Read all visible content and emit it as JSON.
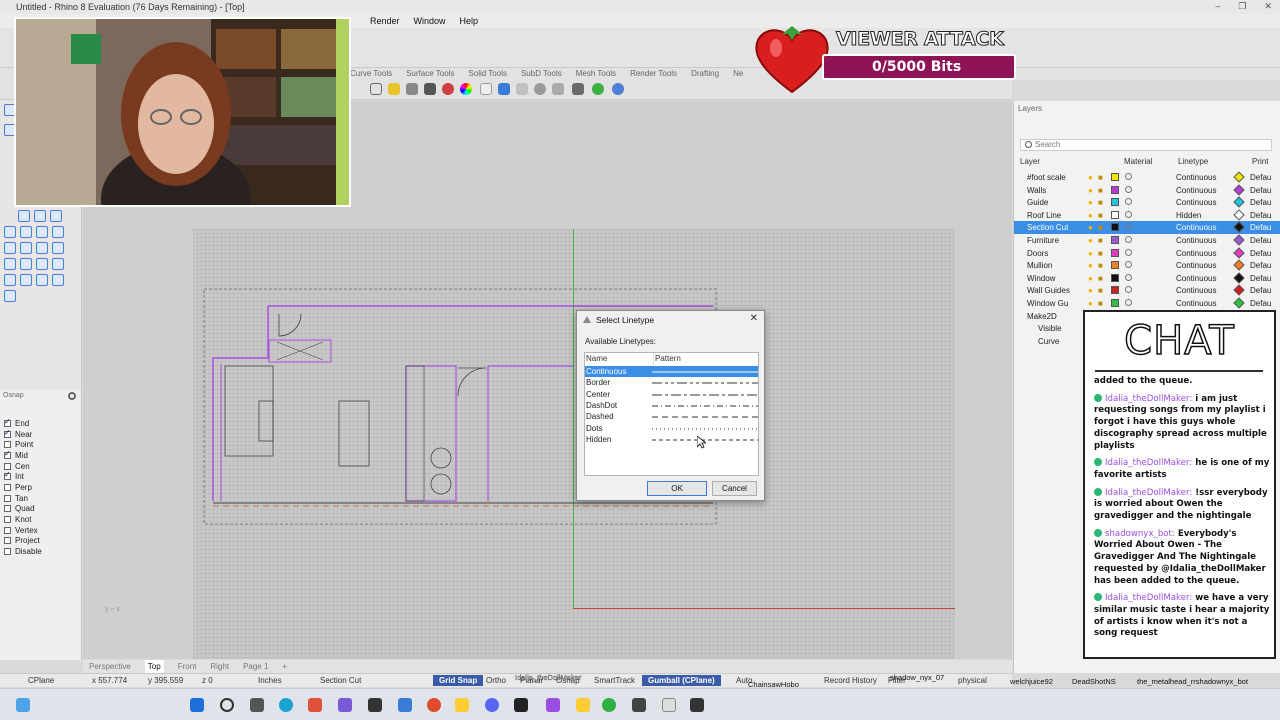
{
  "window": {
    "title": "Untitled - Rhino 8 Evaluation (76 Days Remaining) - [Top]",
    "controls": [
      "–",
      "❐",
      "✕"
    ]
  },
  "menu": [
    "Render",
    "Window",
    "Help"
  ],
  "toolbar_tabs": [
    "Drafting",
    "Curve Tools",
    "Surface Tools",
    "Solid Tools",
    "SubD Tools",
    "Mesh Tools",
    "Render Tools",
    "Drafting",
    "Ne"
  ],
  "osnap": {
    "header": "Osnap",
    "items": [
      {
        "label": "End",
        "checked": true
      },
      {
        "label": "Near",
        "checked": true
      },
      {
        "label": "Point",
        "checked": false
      },
      {
        "label": "Mid",
        "checked": true
      },
      {
        "label": "Cen",
        "checked": false
      },
      {
        "label": "Int",
        "checked": true
      },
      {
        "label": "Perp",
        "checked": false
      },
      {
        "label": "Tan",
        "checked": false
      },
      {
        "label": "Quad",
        "checked": false
      },
      {
        "label": "Knot",
        "checked": false
      },
      {
        "label": "Vertex",
        "checked": false
      },
      {
        "label": "Project",
        "checked": false
      },
      {
        "label": "Disable",
        "checked": false
      }
    ]
  },
  "viewport_tabs": [
    "Perspective",
    "Top",
    "Front",
    "Right",
    "Page 1",
    "+"
  ],
  "status": {
    "cplane": "CPlane",
    "x": "x 557.774",
    "y": "y 395.559",
    "z": "z 0",
    "units": "Inches",
    "layer": "Section Cut",
    "grid_snap": "Grid Snap",
    "ortho": "Ortho",
    "planar": "Planar",
    "osnap": "Osnap",
    "smarttrack": "SmartTrack",
    "gumball": "Gumball (CPlane)",
    "auto": "Auto",
    "record": "Record History",
    "filter": "Filter",
    "physical": "physical"
  },
  "layers": {
    "panel_title": "Layers",
    "search_placeholder": "Search",
    "columns": [
      "Layer",
      "Material",
      "Linetype",
      "Print"
    ],
    "rows": [
      {
        "name": "#foot scale",
        "color": "#f2e600",
        "linetype": "Continuous",
        "print_color": "#f2e600",
        "print": "Defau",
        "selected": false
      },
      {
        "name": "Walls",
        "color": "#b63bd6",
        "linetype": "Continuous",
        "print_color": "#b63bd6",
        "print": "Defau",
        "selected": false
      },
      {
        "name": "Guide",
        "color": "#24c3e0",
        "linetype": "Continuous",
        "print_color": "#24c3e0",
        "print": "Defau",
        "selected": false
      },
      {
        "name": "Roof Line",
        "color": "#ffffff",
        "linetype": "Hidden",
        "print_color": "#ffffff",
        "print": "Defau",
        "selected": false
      },
      {
        "name": "Section Cut",
        "color": "#111111",
        "linetype": "Continuous",
        "print_color": "#111111",
        "print": "Defau",
        "selected": true
      },
      {
        "name": "Furniture",
        "color": "#9a5ad6",
        "linetype": "Continuous",
        "print_color": "#9a5ad6",
        "print": "Defau",
        "selected": false
      },
      {
        "name": "Doors",
        "color": "#e040c0",
        "linetype": "Continuous",
        "print_color": "#e040c0",
        "print": "Defau",
        "selected": false
      },
      {
        "name": "Mullion",
        "color": "#f08020",
        "linetype": "Continuous",
        "print_color": "#f08020",
        "print": "Defau",
        "selected": false
      },
      {
        "name": "Window",
        "color": "#111111",
        "linetype": "Continuous",
        "print_color": "#111111",
        "print": "Defau",
        "selected": false
      },
      {
        "name": "Wall Guides",
        "color": "#d02020",
        "linetype": "Continuous",
        "print_color": "#d02020",
        "print": "Defau",
        "selected": false
      },
      {
        "name": "Window Gu",
        "color": "#2fc040",
        "linetype": "Continuous",
        "print_color": "#2fc040",
        "print": "Defau",
        "selected": false
      },
      {
        "name": "Make2D",
        "color": "#111111",
        "linetype": "Continuous",
        "print_color": "#111111",
        "print": "Defau",
        "selected": false
      },
      {
        "name": "Visible",
        "color": "#111111",
        "linetype": "Continuous",
        "print_color": "#111111",
        "print": "Defau",
        "selected": false
      },
      {
        "name": "Curve",
        "color": "#111111",
        "linetype": "Continuous",
        "print_color": "#111111",
        "print": "Defau",
        "selected": false
      }
    ]
  },
  "dialog": {
    "title": "Select Linetype",
    "available_label": "Available Linetypes:",
    "col_name": "Name",
    "col_pattern": "Pattern",
    "linetypes": [
      {
        "name": "Continuous",
        "pattern": "",
        "selected": true
      },
      {
        "name": "Border",
        "pattern": "10 3 3 3 3 3",
        "selected": false
      },
      {
        "name": "Center",
        "pattern": "10 3 3 3",
        "selected": false
      },
      {
        "name": "DashDot",
        "pattern": "6 3 1 3",
        "selected": false
      },
      {
        "name": "Dashed",
        "pattern": "6 4",
        "selected": false
      },
      {
        "name": "Dots",
        "pattern": "1 3",
        "selected": false
      },
      {
        "name": "Hidden",
        "pattern": "4 3",
        "selected": false
      }
    ],
    "ok": "OK",
    "cancel": "Cancel"
  },
  "overlay": {
    "viewer_attack_title": "VIEWER ATTACK",
    "bits_progress": "0/5000 Bits",
    "bits_fraction": 0.0
  },
  "chat": {
    "title": "CHAT",
    "messages": [
      {
        "user": "",
        "text": "added to the queue."
      },
      {
        "user": "Idalia_theDollMaker:",
        "text": "i am just requesting songs from my playlist i forgot i have this guys whole discography spread across multiple playlists"
      },
      {
        "user": "Idalia_theDollMaker:",
        "text": "he is one of my favorite artists"
      },
      {
        "user": "Idalia_theDollMaker:",
        "text": "!ssr everybody is worried about Owen the gravedigger and the nightingale"
      },
      {
        "user": "shadownyx_bot:",
        "text": "Everybody's Worried About Owen - The Gravedigger And The Nightingale requested by @Idalia_theDollMaker has been added to the queue."
      },
      {
        "user": "Idalia_theDollMaker:",
        "text": "we have a very similar music taste i hear a majority of artists i know when it's not a song request"
      }
    ]
  },
  "taskbar_labels": {
    "a": "Idalia_theDollMaker",
    "b": "ChainsawHobo",
    "c": "shadow_nyx_07",
    "d": "welchjuice92",
    "e": "DeadShotNS",
    "f": "the_metalhead_rrshadownyx_bot"
  }
}
